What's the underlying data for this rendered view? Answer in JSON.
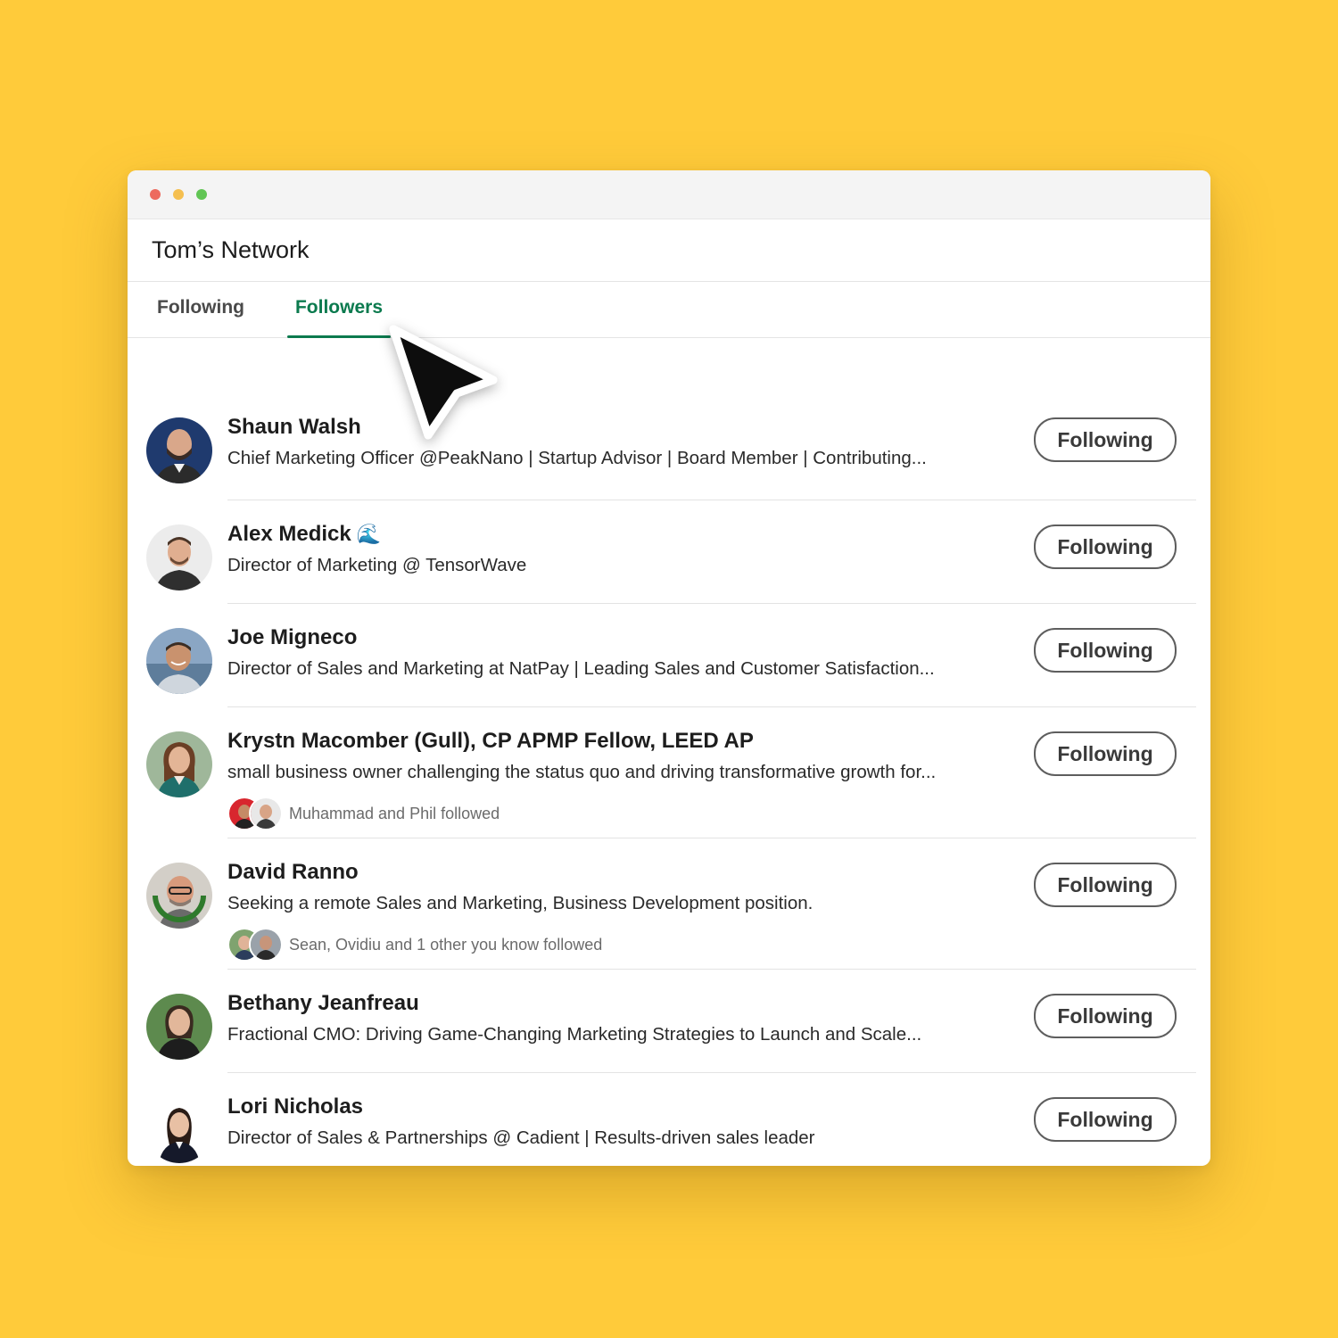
{
  "window": {
    "title": "Tom’s Network",
    "traffic_lights": [
      "#ED6A5E",
      "#F5BF4F",
      "#61C554"
    ]
  },
  "tabs": [
    {
      "label": "Following",
      "active": false
    },
    {
      "label": "Followers",
      "active": true
    }
  ],
  "colors": {
    "background": "#FFCB3A",
    "accent": "#0B7A4E",
    "button_border": "#5e5e5e"
  },
  "followers": [
    {
      "name": "Shaun Walsh",
      "headline": "Chief Marketing Officer @PeakNano | Startup Advisor | Board Member | Contributing...",
      "button": "Following",
      "avatar_icon": "profile-photo"
    },
    {
      "name": "Alex Medick",
      "name_emoji": "🌊",
      "headline": "Director of Marketing @ TensorWave",
      "button": "Following",
      "avatar_icon": "profile-photo"
    },
    {
      "name": "Joe Migneco",
      "headline": "Director of Sales and Marketing at NatPay | Leading Sales and Customer Satisfaction...",
      "button": "Following",
      "avatar_icon": "profile-photo"
    },
    {
      "name": "Krystn Macomber (Gull), CP APMP Fellow, LEED AP",
      "headline": "small business owner challenging the status quo and driving transformative growth for...",
      "mutual": "Muhammad and Phil followed",
      "button": "Following",
      "avatar_icon": "profile-photo"
    },
    {
      "name": "David Ranno",
      "headline": "Seeking a remote Sales and Marketing, Business Development position.",
      "mutual": "Sean, Ovidiu and 1 other you know followed",
      "button": "Following",
      "avatar_icon": "profile-photo-opentowork"
    },
    {
      "name": "Bethany Jeanfreau",
      "headline": "Fractional CMO: Driving Game-Changing Marketing Strategies to Launch and Scale...",
      "button": "Following",
      "avatar_icon": "profile-photo"
    },
    {
      "name": "Lori Nicholas",
      "headline": "Director of Sales & Partnerships @ Cadient | Results-driven sales leader",
      "button": "Following",
      "avatar_icon": "profile-photo"
    }
  ]
}
